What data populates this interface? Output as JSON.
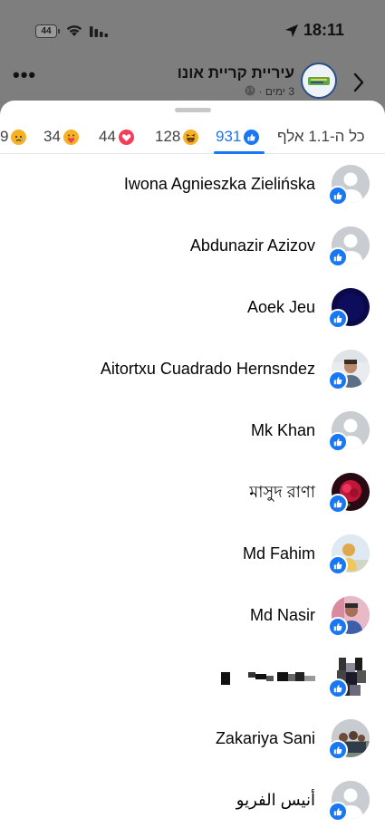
{
  "status": {
    "battery": "44",
    "time": "18:11"
  },
  "post": {
    "page_name": "עיריית קריית אונו",
    "meta": "3 ימים ·"
  },
  "tabs": {
    "all": "כל ה-1.1 אלף",
    "like": "931",
    "haha": "128",
    "love": "44",
    "care": "34",
    "sad": "9"
  },
  "reactors": [
    {
      "name": "Iwona Agnieszka Zielińska",
      "avatar": "default",
      "reaction": "like"
    },
    {
      "name": "Abdunazir Azizov",
      "avatar": "default",
      "reaction": "like"
    },
    {
      "name": "Aoek Jeu",
      "avatar": "navy",
      "reaction": "like"
    },
    {
      "name": "Aitortxu Cuadrado Hernsndez",
      "avatar": "photo",
      "reaction": "like"
    },
    {
      "name": "Mk Khan",
      "avatar": "default",
      "reaction": "like"
    },
    {
      "name": "মাসুদ রাণা",
      "avatar": "rose",
      "reaction": "like"
    },
    {
      "name": "Md Fahim",
      "avatar": "photo",
      "reaction": "like"
    },
    {
      "name": "Md Nasir",
      "avatar": "photo",
      "reaction": "like"
    },
    {
      "name": "",
      "avatar": "pixelated",
      "reaction": "like"
    },
    {
      "name": "Zakariya Sani",
      "avatar": "photo",
      "reaction": "like"
    },
    {
      "name": "أنيس الفريو",
      "avatar": "default",
      "reaction": "like"
    }
  ],
  "colors": {
    "accent": "#1877f2",
    "love": "#f33e58",
    "haha": "#f7b125"
  }
}
